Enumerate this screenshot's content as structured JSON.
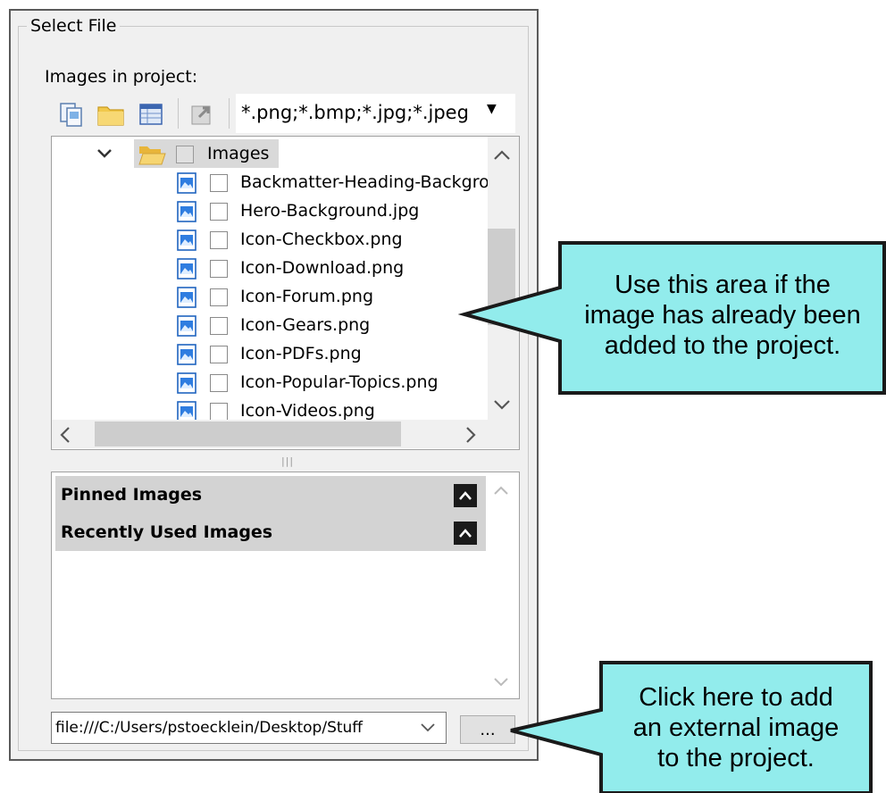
{
  "group": {
    "title": "Select File",
    "images_label": "Images in project:"
  },
  "toolbar": {
    "buttons": [
      {
        "icon": "copy-icon"
      },
      {
        "icon": "folder-icon"
      },
      {
        "icon": "table-icon"
      },
      {
        "icon": "import-icon"
      }
    ],
    "filter": "*.png;*.bmp;*.jpg;*.jpeg"
  },
  "tree": {
    "folder": "Images",
    "files": [
      "Backmatter-Heading-Backgro",
      "Hero-Background.jpg",
      "Icon-Checkbox.png",
      "Icon-Download.png",
      "Icon-Forum.png",
      "Icon-Gears.png",
      "Icon-PDFs.png",
      "Icon-Popular-Topics.png",
      "Icon-Videos.png"
    ]
  },
  "sections": {
    "pinned": "Pinned Images",
    "recent": "Recently Used Images"
  },
  "path": {
    "value": "file:///C:/Users/pstoecklein/Desktop/Stuff"
  },
  "browse": {
    "label": "..."
  },
  "callouts": {
    "top": [
      "Use this area if the",
      "image has already been",
      "added to the project."
    ],
    "bottom": [
      "Click here to add",
      "an external image",
      "to the project."
    ]
  },
  "colors": {
    "callout_fill": "#92ecec",
    "callout_border": "#1a1a1a",
    "section_bg": "#d3d3d3"
  }
}
